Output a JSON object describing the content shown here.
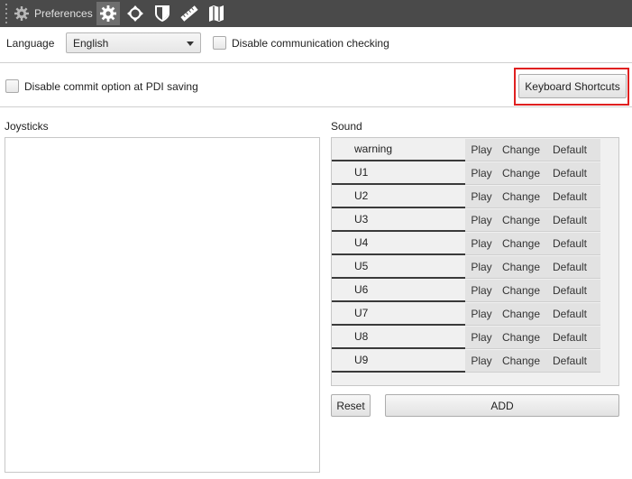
{
  "toolbar": {
    "title": "Preferences",
    "buttons": [
      {
        "icon": "gear-icon",
        "active": true
      },
      {
        "icon": "move-arrows-icon"
      },
      {
        "icon": "shield-icon"
      },
      {
        "icon": "ruler-icon"
      },
      {
        "icon": "map-icon"
      }
    ]
  },
  "language": {
    "label": "Language",
    "selected": "English"
  },
  "options": {
    "disable_comm_check": "Disable communication checking",
    "disable_commit": "Disable commit option at PDI saving",
    "keyboard_shortcuts": "Keyboard Shortcuts"
  },
  "joysticks": {
    "label": "Joysticks"
  },
  "sound": {
    "label": "Sound",
    "play_label": "Play",
    "change_label": "Change",
    "default_label": "Default",
    "items": [
      "warning",
      "U1",
      "U2",
      "U3",
      "U4",
      "U5",
      "U6",
      "U7",
      "U8",
      "U9"
    ],
    "reset_label": "Reset",
    "add_label": "ADD"
  },
  "colors": {
    "titlebar": "#4a4a4a",
    "highlight": "#e02020"
  }
}
